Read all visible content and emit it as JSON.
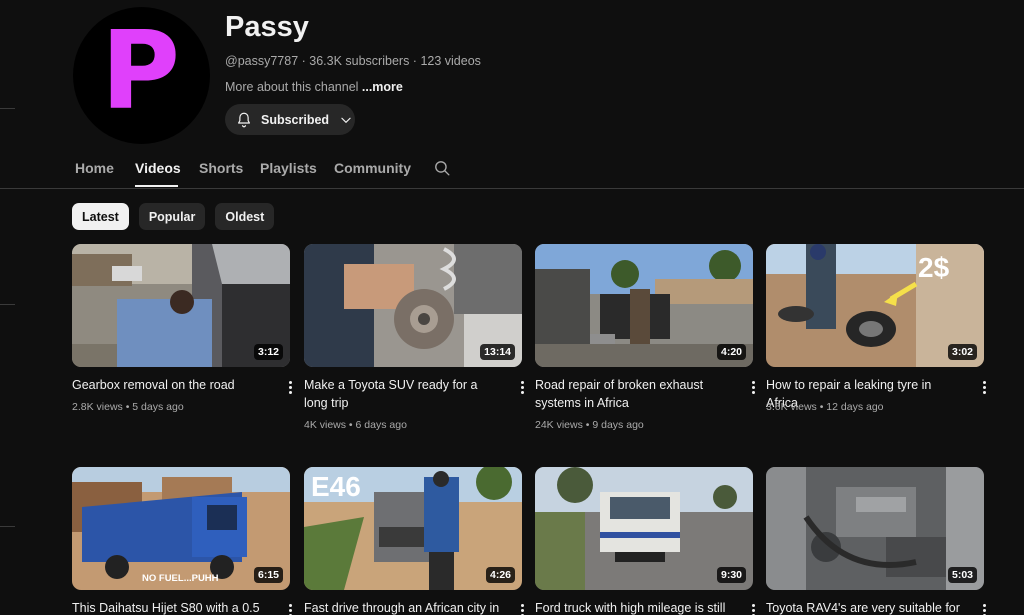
{
  "channel": {
    "name": "Passy",
    "avatar_letter": "P",
    "avatar_color": "#e040fb",
    "handle": "@passy7787",
    "subscribers": "36.3K subscribers",
    "video_count": "123 videos",
    "separator": " · ",
    "about_text": "More about this channel ",
    "about_more": "...more",
    "subscribe_label": "Subscribed"
  },
  "tabs": [
    {
      "label": "Home"
    },
    {
      "label": "Videos"
    },
    {
      "label": "Shorts"
    },
    {
      "label": "Playlists"
    },
    {
      "label": "Community"
    }
  ],
  "active_tab": "Videos",
  "chips": [
    {
      "label": "Latest"
    },
    {
      "label": "Popular"
    },
    {
      "label": "Oldest"
    }
  ],
  "videos": [
    {
      "title": "Gearbox removal on the road",
      "duration": "3:12",
      "views": "2.8K views",
      "age": "5 days ago"
    },
    {
      "title": "Make a Toyota SUV ready for a long trip",
      "duration": "13:14",
      "views": "4K views",
      "age": "6 days ago"
    },
    {
      "title": "Road repair of broken exhaust systems in Africa",
      "duration": "4:20",
      "views": "24K views",
      "age": "9 days ago"
    },
    {
      "title": "How to repair a leaking tyre in Africa",
      "duration": "3:02",
      "views": "3.6K views",
      "age": "12 days ago",
      "overlay": "2$"
    },
    {
      "title": "This Daihatsu Hijet S80 with a 0.5",
      "duration": "6:15",
      "overlay": "NO FUEL...PUHH"
    },
    {
      "title": "Fast drive through an African city in",
      "duration": "4:26",
      "overlay": "E46"
    },
    {
      "title": "Ford truck with high mileage is still",
      "duration": "9:30"
    },
    {
      "title": "Toyota RAV4's are very suitable for",
      "duration": "5:03"
    }
  ],
  "stats_separator": " • "
}
